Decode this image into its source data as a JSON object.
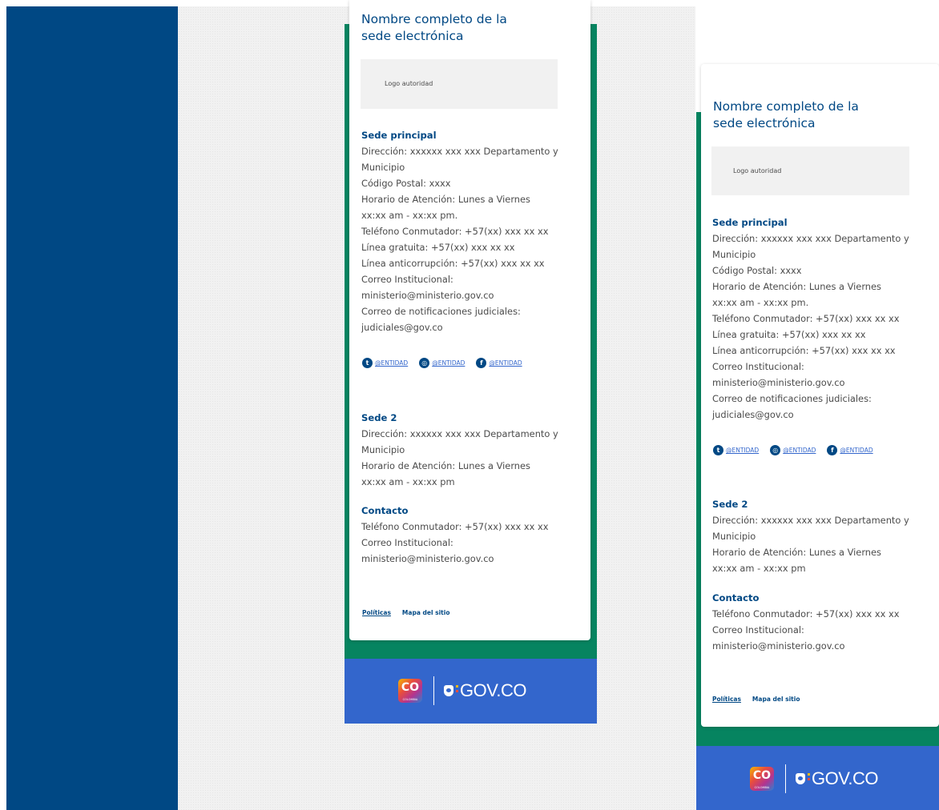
{
  "footer": {
    "title_line1": "Nombre completo de la",
    "title_line2": "sede electrónica",
    "logo_label": "Logo autoridad",
    "main_office": {
      "heading": "Sede principal",
      "lines": [
        "Dirección: xxxxxx xxx xxx Departamento y",
        "Municipio",
        "Código Postal: xxxx",
        "Horario de Atención: Lunes a Viernes",
        "xx:xx am - xx:xx pm.",
        "Teléfono Conmutador: +57(xx) xxx xx xx",
        "Línea gratuita: +57(xx) xxx xx xx",
        "Línea anticorrupción: +57(xx) xxx xx xx",
        "Correo Institucional:",
        "ministerio@ministerio.gov.co",
        "Correo de notificaciones judiciales:",
        "judiciales@gov.co"
      ]
    },
    "social": [
      {
        "icon": "twitter-icon",
        "glyph": "t",
        "handle": "@ENTIDAD"
      },
      {
        "icon": "instagram-icon",
        "glyph": "◎",
        "handle": "@ENTIDAD"
      },
      {
        "icon": "facebook-icon",
        "glyph": "f",
        "handle": "@ENTIDAD"
      }
    ],
    "branch": {
      "heading": "Sede 2",
      "lines": [
        "Dirección: xxxxxx xxx xxx Departamento y",
        "Municipio",
        "Horario de Atención: Lunes a Viernes",
        "xx:xx am - xx:xx pm"
      ]
    },
    "contact": {
      "heading": "Contacto",
      "lines": [
        "Teléfono Conmutador: +57(xx) xxx xx xx",
        "Correo Institucional:",
        "ministerio@ministerio.gov.co"
      ]
    },
    "links": {
      "policies": "Políticas",
      "sitemap": "Mapa del sitio"
    },
    "co_badge": {
      "main": "CO",
      "sub": "COLOMBIA"
    },
    "gov_logo_text": "GOV.CO"
  },
  "colors": {
    "sidebar": "#004884",
    "accent_green": "#068460",
    "gov_blue": "#3366cc",
    "heading_blue": "#004884",
    "body_text": "#4b4b4b"
  }
}
